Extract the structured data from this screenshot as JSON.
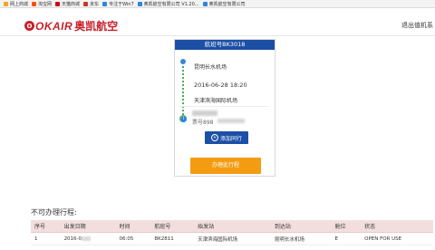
{
  "bookmarks": [
    {
      "label": "网上商城",
      "color": "#f5a623"
    },
    {
      "label": "淘宝网",
      "color": "#ff5000"
    },
    {
      "label": "天猫商城",
      "color": "#d0021b"
    },
    {
      "label": "京东",
      "color": "#c0392b"
    },
    {
      "label": "专注于Win7",
      "color": "#2e86de"
    },
    {
      "label": "奥凯航空有限公司 V1.20...",
      "color": "#2e86de"
    },
    {
      "label": "奥凯航空有限公司",
      "color": "#2e86de"
    }
  ],
  "header": {
    "logo_mark": "O",
    "logo_en": "OKAIR",
    "logo_cn": "奥凯航空",
    "logout": "退出值机系"
  },
  "card": {
    "title": "航班号BK3018",
    "departure": "昆明长水机场",
    "datetime": "2016-06-28 18:20",
    "arrival": "天津滨海国际机场",
    "passenger_id_prefix": "票号898",
    "add_button": "添加同行",
    "add_icon": "+",
    "pax_icon": "i"
  },
  "checkin_button": "办理此行程",
  "section_title": "不可办理行程:",
  "table": {
    "headers": [
      "序号",
      "出发日期",
      "时间",
      "航班号",
      "始发站",
      "到达站",
      "舱位",
      "状态"
    ],
    "rows": [
      [
        "1",
        "2016-0",
        "06:05",
        "BK2811",
        "天津滨海国际机场",
        "昆明长水机场",
        "E",
        "OPEN FOR USE"
      ]
    ]
  }
}
